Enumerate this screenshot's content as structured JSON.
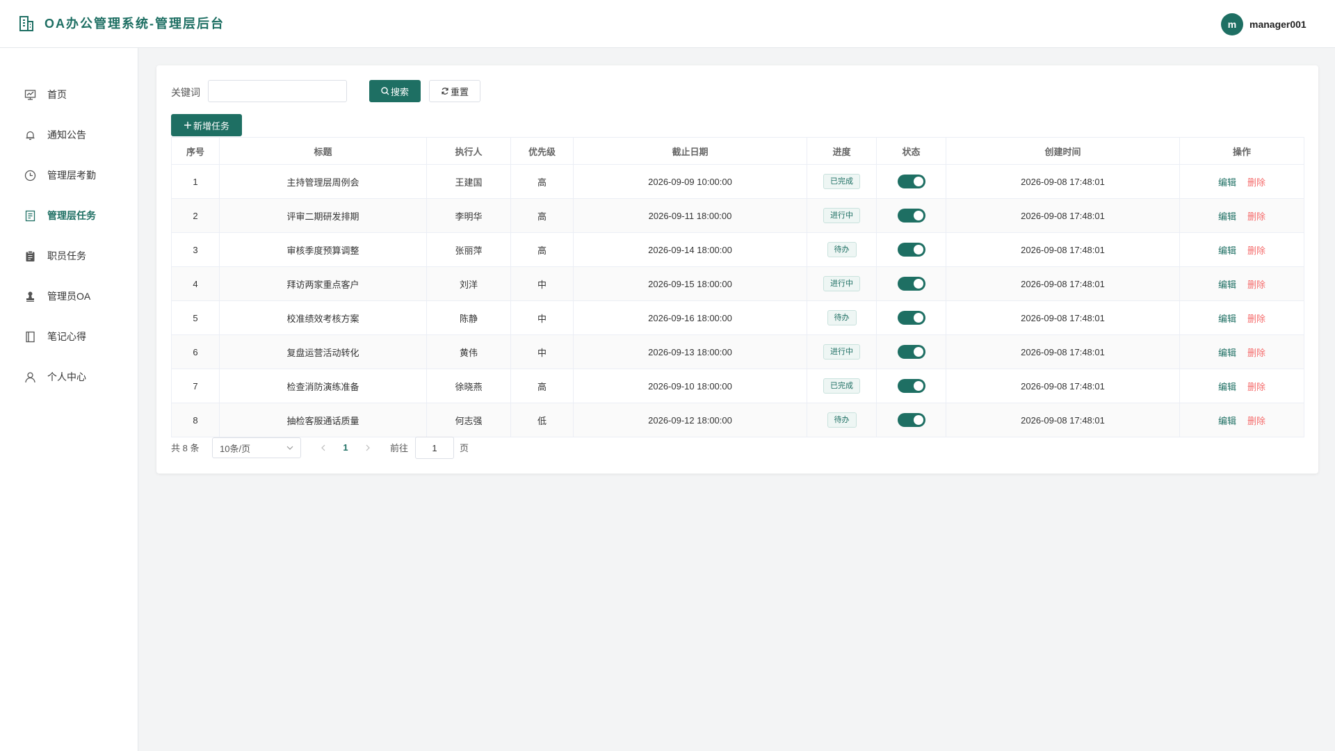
{
  "header": {
    "title": "OA办公管理系统-管理层后台",
    "avatar_letter": "m",
    "username": "manager001"
  },
  "sidebar": {
    "items": [
      {
        "label": "首页",
        "icon": "home-icon"
      },
      {
        "label": "通知公告",
        "icon": "bell-icon"
      },
      {
        "label": "管理层考勤",
        "icon": "clock-icon"
      },
      {
        "label": "管理层任务",
        "icon": "document-icon",
        "active": true
      },
      {
        "label": "职员任务",
        "icon": "clipboard-icon"
      },
      {
        "label": "管理员OA",
        "icon": "stamp-icon"
      },
      {
        "label": "笔记心得",
        "icon": "notebook-icon"
      },
      {
        "label": "个人中心",
        "icon": "user-icon"
      }
    ]
  },
  "search": {
    "label": "关键词",
    "value": "",
    "placeholder": "",
    "search_label": "搜索",
    "reset_label": "重置",
    "add_label": "新增任务"
  },
  "table": {
    "columns": [
      "序号",
      "标题",
      "执行人",
      "优先级",
      "截止日期",
      "进度",
      "状态",
      "创建时间",
      "操作"
    ],
    "edit_label": "编辑",
    "delete_label": "删除",
    "rows": [
      {
        "no": "1",
        "title": "主持管理层周例会",
        "assignee": "王建国",
        "priority": "高",
        "deadline": "2026-09-09 10:00:00",
        "progress": "已完成",
        "status_on": true,
        "created": "2026-09-08 17:48:01"
      },
      {
        "no": "2",
        "title": "评审二期研发排期",
        "assignee": "李明华",
        "priority": "高",
        "deadline": "2026-09-11 18:00:00",
        "progress": "进行中",
        "status_on": true,
        "created": "2026-09-08 17:48:01"
      },
      {
        "no": "3",
        "title": "审核季度预算调整",
        "assignee": "张丽萍",
        "priority": "高",
        "deadline": "2026-09-14 18:00:00",
        "progress": "待办",
        "status_on": true,
        "created": "2026-09-08 17:48:01"
      },
      {
        "no": "4",
        "title": "拜访两家重点客户",
        "assignee": "刘洋",
        "priority": "中",
        "deadline": "2026-09-15 18:00:00",
        "progress": "进行中",
        "status_on": true,
        "created": "2026-09-08 17:48:01"
      },
      {
        "no": "5",
        "title": "校准绩效考核方案",
        "assignee": "陈静",
        "priority": "中",
        "deadline": "2026-09-16 18:00:00",
        "progress": "待办",
        "status_on": true,
        "created": "2026-09-08 17:48:01"
      },
      {
        "no": "6",
        "title": "复盘运营活动转化",
        "assignee": "黄伟",
        "priority": "中",
        "deadline": "2026-09-13 18:00:00",
        "progress": "进行中",
        "status_on": true,
        "created": "2026-09-08 17:48:01"
      },
      {
        "no": "7",
        "title": "检查消防演练准备",
        "assignee": "徐晓燕",
        "priority": "高",
        "deadline": "2026-09-10 18:00:00",
        "progress": "已完成",
        "status_on": true,
        "created": "2026-09-08 17:48:01"
      },
      {
        "no": "8",
        "title": "抽检客服通话质量",
        "assignee": "何志强",
        "priority": "低",
        "deadline": "2026-09-12 18:00:00",
        "progress": "待办",
        "status_on": true,
        "created": "2026-09-08 17:48:01"
      }
    ]
  },
  "pagination": {
    "total_text": "共 8 条",
    "page_size": "10条/页",
    "current_page": "1",
    "goto_label": "前往",
    "goto_value": "1",
    "goto_suffix": "页"
  },
  "colors": {
    "accent": "#1e6f63",
    "danger": "#f56c6c",
    "background": "#f3f4f5"
  }
}
